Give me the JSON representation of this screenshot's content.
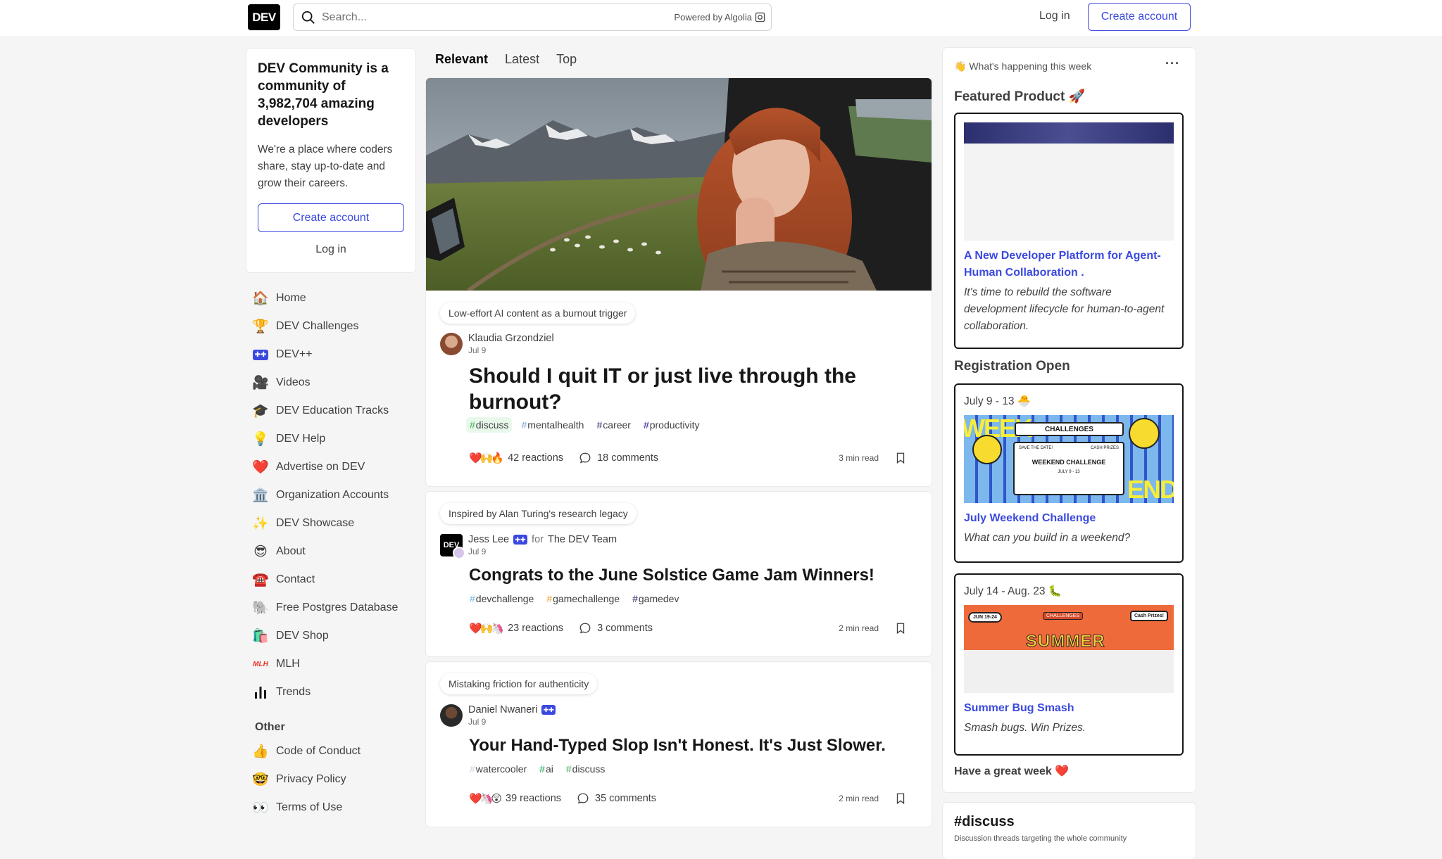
{
  "header": {
    "logo": "DEV",
    "search_placeholder": "Search...",
    "powered_by": "Powered by Algolia",
    "login": "Log in",
    "create_account": "Create account"
  },
  "left_card": {
    "headline": "DEV Community is a community of 3,982,704 amazing developers",
    "body": "We're a place where coders share, stay up-to-date and grow their careers.",
    "create_account": "Create account",
    "login": "Log in"
  },
  "nav": {
    "items": [
      {
        "icon": "house-icon",
        "glyph": "🏠",
        "label": "Home"
      },
      {
        "icon": "trophy-icon",
        "glyph": "🏆",
        "label": "DEV Challenges"
      },
      {
        "icon": "dev-plus-icon",
        "glyph": "➕",
        "label": "DEV++"
      },
      {
        "icon": "video-camera-icon",
        "glyph": "🎥",
        "label": "Videos"
      },
      {
        "icon": "graduation-cap-icon",
        "glyph": "🎓",
        "label": "DEV Education Tracks"
      },
      {
        "icon": "lightbulb-icon",
        "glyph": "💡",
        "label": "DEV Help"
      },
      {
        "icon": "heart-icon",
        "glyph": "❤️",
        "label": "Advertise on DEV"
      },
      {
        "icon": "classical-building-icon",
        "glyph": "🏛️",
        "label": "Organization Accounts"
      },
      {
        "icon": "sparkles-icon",
        "glyph": "✨",
        "label": "DEV Showcase"
      },
      {
        "icon": "sunglasses-face-icon",
        "glyph": "😎",
        "label": "About"
      },
      {
        "icon": "phone-icon",
        "glyph": "☎️",
        "label": "Contact"
      },
      {
        "icon": "elephant-icon",
        "glyph": "🐘",
        "label": "Free Postgres Database"
      },
      {
        "icon": "shopping-bags-icon",
        "glyph": "🛍️",
        "label": "DEV Shop"
      },
      {
        "icon": "mlh-logo-icon",
        "glyph": "MLH",
        "label": "MLH"
      },
      {
        "icon": "bar-chart-icon",
        "glyph": "📊",
        "label": "Trends"
      }
    ],
    "other_heading": "Other",
    "other_items": [
      {
        "icon": "thumbs-up-icon",
        "glyph": "👍",
        "label": "Code of Conduct"
      },
      {
        "icon": "nerd-face-icon",
        "glyph": "🤓",
        "label": "Privacy Policy"
      },
      {
        "icon": "eyes-icon",
        "glyph": "👀",
        "label": "Terms of Use"
      }
    ]
  },
  "feed": {
    "tabs": [
      "Relevant",
      "Latest",
      "Top"
    ],
    "articles": [
      {
        "context": "Low-effort AI content as a burnout trigger",
        "author": "Klaudia Grzondziel",
        "date": "Jul 9",
        "title": "Should I quit IT or just live through the burnout?",
        "tags": [
          {
            "name": "discuss",
            "color": "#3ea95a"
          },
          {
            "name": "mentalhealth",
            "color": "#72a0d8"
          },
          {
            "name": "career",
            "color": "#2a2566"
          },
          {
            "name": "productivity",
            "color": "#2a0798"
          }
        ],
        "reactions": "42 reactions",
        "comments": "18 comments",
        "read_time": "3 min read"
      },
      {
        "context": "Inspired by Alan Turing's research legacy",
        "author": "Jess Lee",
        "for_label": "for",
        "org": "The DEV Team",
        "date": "Jul 9",
        "title": "Congrats to the June Solstice Game Jam Winners!",
        "tags": [
          {
            "name": "devchallenge",
            "color": "#6fb6e0"
          },
          {
            "name": "gamechallenge",
            "color": "#e6a63a"
          },
          {
            "name": "gamedev",
            "color": "#2a2566"
          }
        ],
        "reactions": "23 reactions",
        "comments": "3 comments",
        "read_time": "2 min read"
      },
      {
        "context": "Mistaking friction for authenticity",
        "author": "Daniel Nwaneri",
        "date": "Jul 9",
        "title": "Your Hand-Typed Slop Isn't Honest. It's Just Slower.",
        "tags": [
          {
            "name": "watercooler",
            "color": "#c4d2e0"
          },
          {
            "name": "ai",
            "color": "#17a352"
          },
          {
            "name": "discuss",
            "color": "#3ea95a"
          }
        ],
        "reactions": "39 reactions",
        "comments": "35 comments",
        "read_time": "2 min read"
      }
    ]
  },
  "sidebar": {
    "happening": "👋 What's happening this week",
    "featured_heading": "Featured Product 🚀",
    "featured": {
      "title": "A New Developer Platform for Agent-Human Collaboration .",
      "desc": "It's time to rebuild the software development lifecycle for human-to-agent collaboration."
    },
    "registration_heading": "Registration Open",
    "events": [
      {
        "date": "July 9 - 13 🐣",
        "title": "July Weekend Challenge",
        "desc": "What can you build in a weekend?",
        "banner_text": "WEEKEND CHALLENGE",
        "banner_sub": "JULY 9 - 13",
        "save": "SAVE THE DATE!",
        "cash": "CASH PRIZES",
        "brand": "CHALLENGES"
      },
      {
        "date": "July 14 - Aug. 23 🐛",
        "title": "Summer Bug Smash",
        "desc": "Smash bugs. Win Prizes.",
        "banner_text": "SUMMER",
        "banner_sub": "JUN 19-24",
        "cash": "Cash Prizes!",
        "brand": "CHALLENGES"
      }
    ],
    "closing": "Have a great week ❤️"
  },
  "discuss_card": {
    "heading": "#discuss",
    "sub": "Discussion threads targeting the whole community"
  },
  "colors": {
    "accent": "#3b49df",
    "background": "#f5f5f5"
  }
}
